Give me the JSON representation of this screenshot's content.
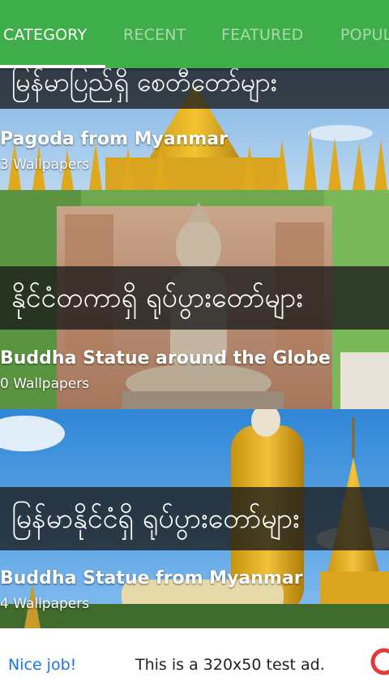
{
  "tabs": [
    {
      "label": "CATEGORY",
      "active": true
    },
    {
      "label": "RECENT",
      "active": false
    },
    {
      "label": "FEATURED",
      "active": false
    },
    {
      "label": "POPULAR",
      "active": false
    }
  ],
  "categories": [
    {
      "banner": "မြန်မာပြည်ရှိ စေတီတော်များ",
      "title": "Pagoda from Myanmar",
      "count": "3 Wallpapers"
    },
    {
      "banner": "နိုင်ငံတကာရှိ ရုပ်ပွားတော်များ",
      "title": "Buddha Statue around the Globe",
      "count": "0 Wallpapers"
    },
    {
      "banner": "မြန်မာနိုင်ငံရှိ ရုပ်ပွားတော်များ",
      "title": "Buddha Statue from Myanmar",
      "count": "4 Wallpapers"
    }
  ],
  "ad": {
    "nice": "Nice job!",
    "text": "This is a 320x50 test ad."
  },
  "colors": {
    "accent": "#3fae4a",
    "ad_link": "#1a73e8"
  }
}
